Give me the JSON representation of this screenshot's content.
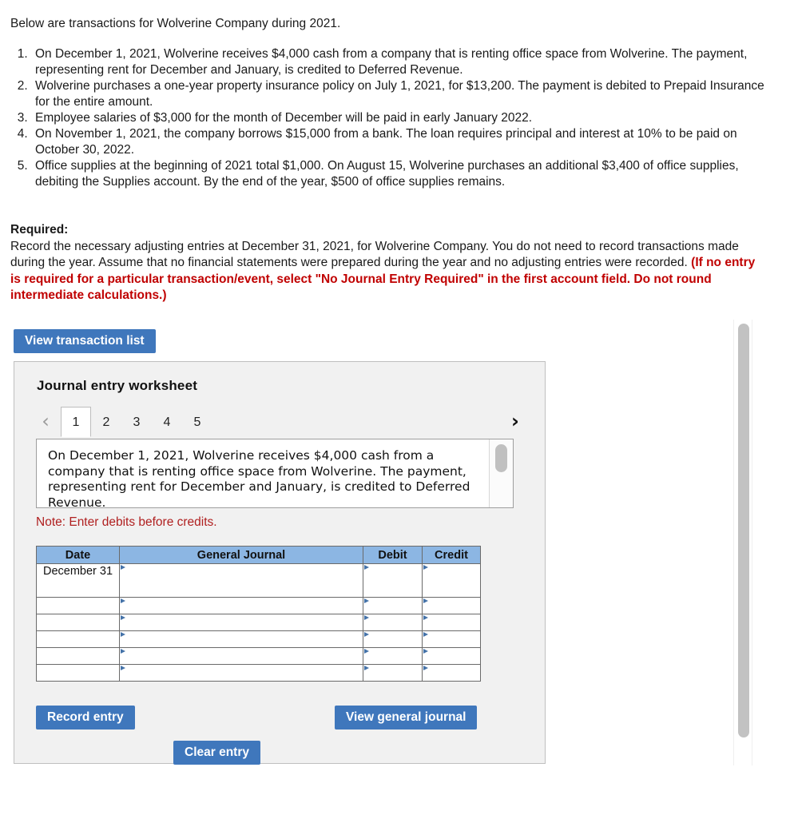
{
  "intro": "Below are transactions for Wolverine Company during 2021.",
  "transactions": [
    "On December 1, 2021, Wolverine receives $4,000 cash from a company that is renting office space from Wolverine. The payment, representing rent for December and January, is credited to Deferred Revenue.",
    "Wolverine purchases a one-year property insurance policy on July 1, 2021, for $13,200. The payment is debited to Prepaid Insurance for the entire amount.",
    "Employee salaries of $3,000 for the month of December will be paid in early January 2022.",
    "On November 1, 2021, the company borrows $15,000 from a bank. The loan requires principal and interest at 10% to be paid on October 30, 2022.",
    "Office supplies at the beginning of 2021 total $1,000. On August 15, Wolverine purchases an additional $3,400 of office supplies, debiting the Supplies account. By the end of the year, $500 of office supplies remains."
  ],
  "required": {
    "label": "Required:",
    "body": "Record the necessary adjusting entries at December 31, 2021, for Wolverine Company. You do not need to record transactions made during the year. Assume that no financial statements were prepared during the year and no adjusting entries were recorded. ",
    "red": "(If no entry is required for a particular transaction/event, select \"No Journal Entry Required\" in the first account field. Do not round intermediate calculations.)"
  },
  "buttons": {
    "view_transaction_list": "View transaction list",
    "record_entry": "Record entry",
    "clear_entry": "Clear entry",
    "view_general_journal": "View general journal"
  },
  "worksheet": {
    "title": "Journal entry worksheet",
    "prev_icon": "chevron-left-icon",
    "next_icon": "chevron-right-icon",
    "tabs": [
      {
        "label": "1",
        "active": true
      },
      {
        "label": "2",
        "active": false
      },
      {
        "label": "3",
        "active": false
      },
      {
        "label": "4",
        "active": false
      },
      {
        "label": "5",
        "active": false
      }
    ],
    "active_tab_description": "On December 1, 2021, Wolverine receives $4,000 cash from a company that is renting office space from Wolverine. The payment, representing rent for December and January, is credited to Deferred Revenue.",
    "note": "Note: Enter debits before credits.",
    "table": {
      "headers": [
        "Date",
        "General Journal",
        "Debit",
        "Credit"
      ],
      "rows": [
        {
          "date": "December 31",
          "general_journal": "",
          "debit": "",
          "credit": ""
        },
        {
          "date": "",
          "general_journal": "",
          "debit": "",
          "credit": ""
        },
        {
          "date": "",
          "general_journal": "",
          "debit": "",
          "credit": ""
        },
        {
          "date": "",
          "general_journal": "",
          "debit": "",
          "credit": ""
        },
        {
          "date": "",
          "general_journal": "",
          "debit": "",
          "credit": ""
        },
        {
          "date": "",
          "general_journal": "",
          "debit": "",
          "credit": ""
        }
      ]
    }
  },
  "colors": {
    "button_blue": "#3f77bc",
    "table_header_blue": "#8cb6e3",
    "red_text": "#c00000",
    "note_red": "#b02020",
    "panel_bg": "#f1f1f1"
  }
}
